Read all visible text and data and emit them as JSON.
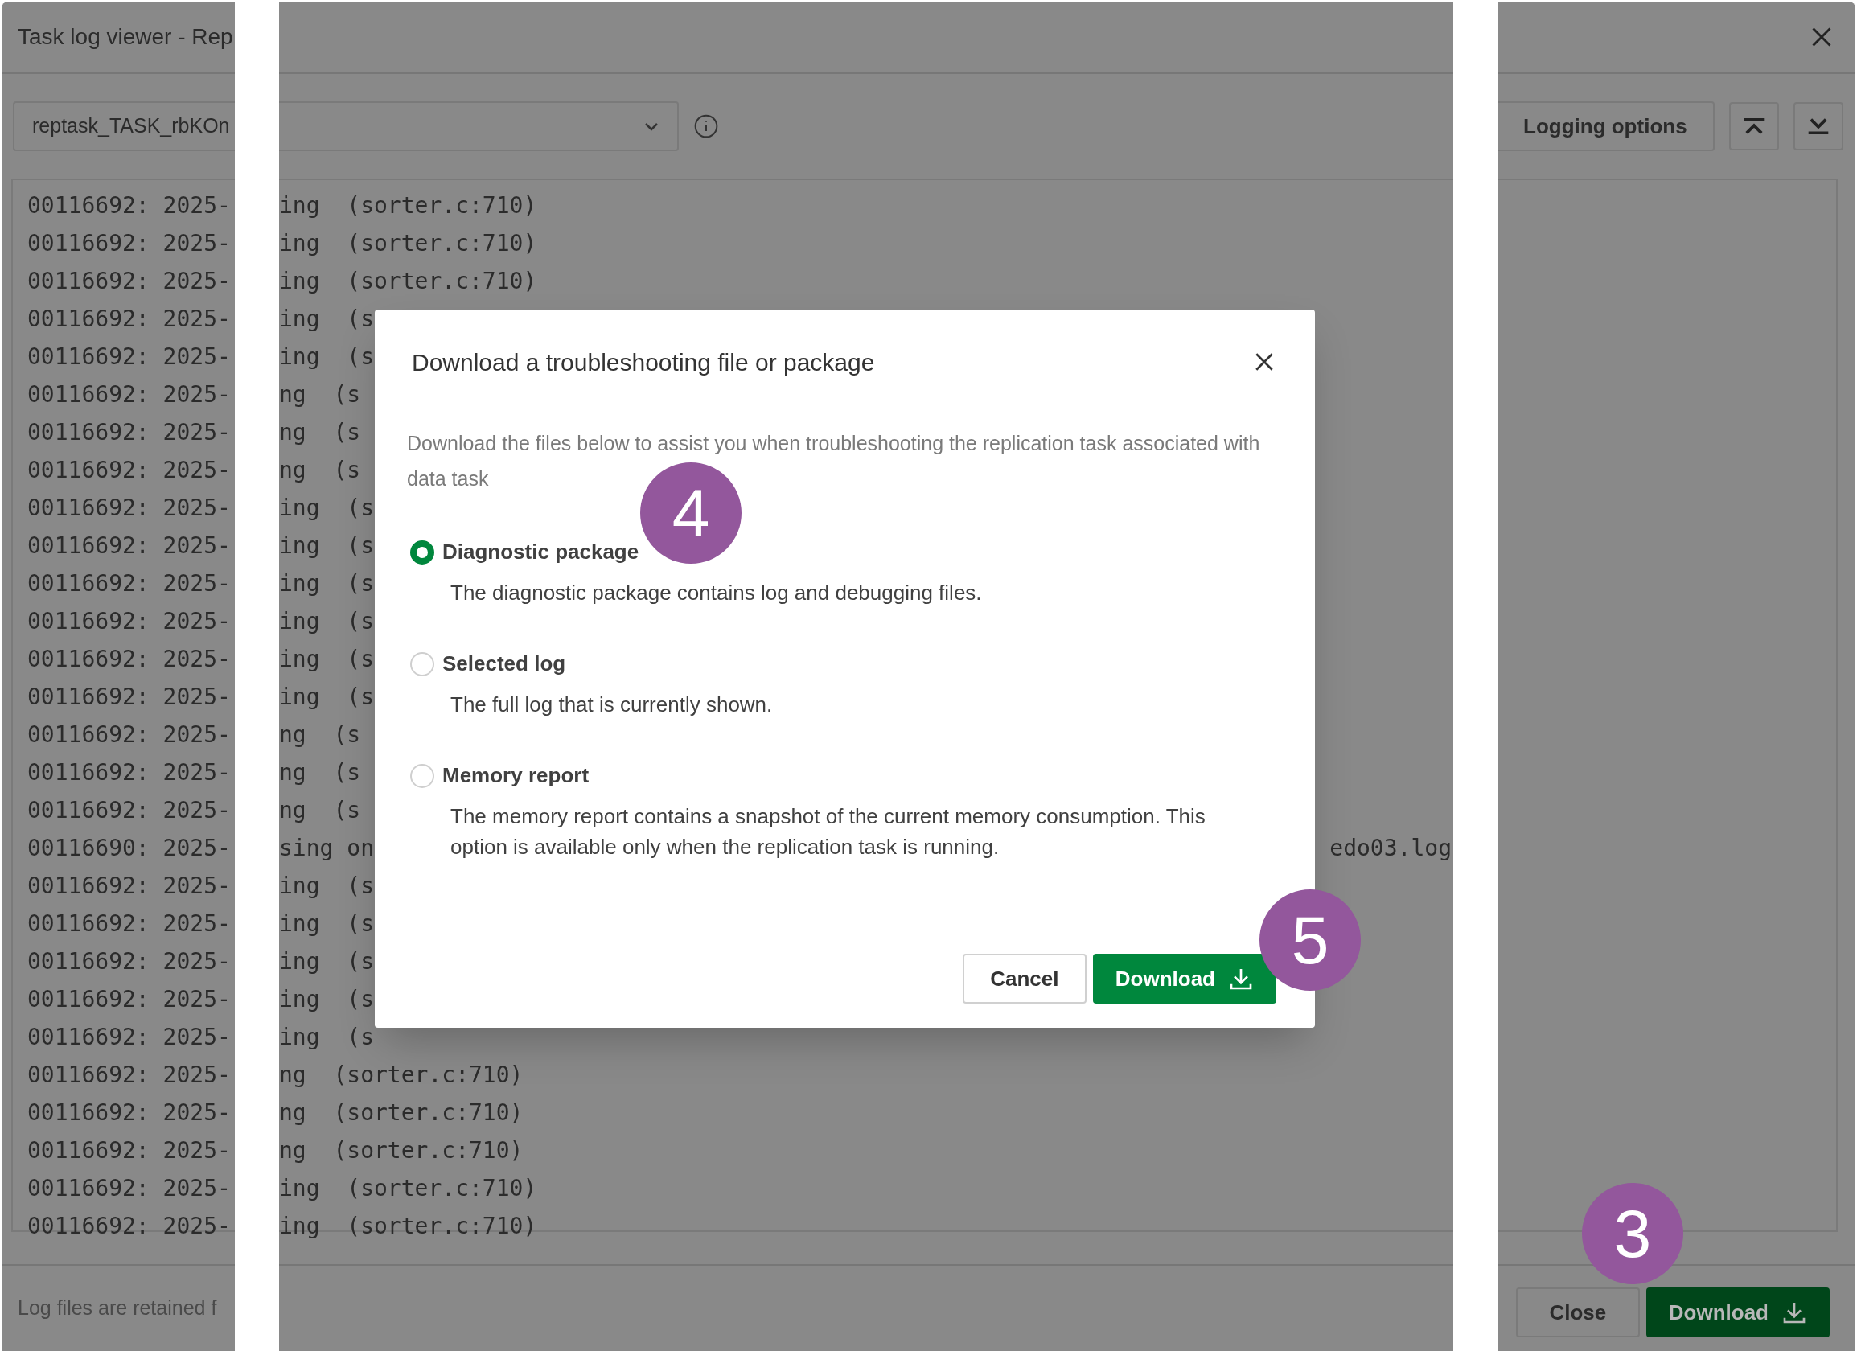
{
  "window": {
    "title": "Task log viewer - Rep"
  },
  "log_selector": {
    "value": "reptask_TASK_rbKOn"
  },
  "toolbar": {
    "logging_options": "Logging options"
  },
  "log": [
    {
      "left": "00116692: 2025-",
      "middle": "ing  (sorter.c:710)"
    },
    {
      "left": "00116692: 2025-",
      "middle": "ing  (sorter.c:710)"
    },
    {
      "left": "00116692: 2025-",
      "middle": "ing  (sorter.c:710)"
    },
    {
      "left": "00116692: 2025-",
      "middle": "ing  (s"
    },
    {
      "left": "00116692: 2025-",
      "middle": "ing  (s"
    },
    {
      "left": "00116692: 2025-",
      "middle": "ng  (s"
    },
    {
      "left": "00116692: 2025-",
      "middle": "ng  (s"
    },
    {
      "left": "00116692: 2025-",
      "middle": "ng  (s"
    },
    {
      "left": "00116692: 2025-",
      "middle": "ing  (s"
    },
    {
      "left": "00116692: 2025-",
      "middle": "ing  (s"
    },
    {
      "left": "00116692: 2025-",
      "middle": "ing  (s"
    },
    {
      "left": "00116692: 2025-",
      "middle": "ing  (s"
    },
    {
      "left": "00116692: 2025-",
      "middle": "ing  (s"
    },
    {
      "left": "00116692: 2025-",
      "middle": "ing  (s"
    },
    {
      "left": "00116692: 2025-",
      "middle": "ng  (s"
    },
    {
      "left": "00116692: 2025-",
      "middle": "ng  (s"
    },
    {
      "left": "00116692: 2025-",
      "middle": "ng  (s"
    },
    {
      "left": "00116690: 2025-",
      "middle": "sing on",
      "right": "edo03.log"
    },
    {
      "left": "00116692: 2025-",
      "middle": "ing  (s"
    },
    {
      "left": "00116692: 2025-",
      "middle": "ing  (s"
    },
    {
      "left": "00116692: 2025-",
      "middle": "ing  (s"
    },
    {
      "left": "00116692: 2025-",
      "middle": "ing  (s"
    },
    {
      "left": "00116692: 2025-",
      "middle": "ing  (s"
    },
    {
      "left": "00116692: 2025-",
      "middle": "ng  (sorter.c:710)"
    },
    {
      "left": "00116692: 2025-",
      "middle": "ng  (sorter.c:710)"
    },
    {
      "left": "00116692: 2025-",
      "middle": "ng  (sorter.c:710)"
    },
    {
      "left": "00116692: 2025-",
      "middle": "ing  (sorter.c:710)"
    },
    {
      "left": "00116692: 2025-",
      "middle": "ing  (sorter.c:710)"
    }
  ],
  "footer": {
    "note": "Log files are retained f",
    "buttons": [
      {
        "label": "Close",
        "kind": "secondary"
      },
      {
        "label": "Download",
        "kind": "primary",
        "callout": "3"
      }
    ]
  },
  "dialog": {
    "title": "Download a troubleshooting file or package",
    "description": "Download the files below to assist you when troubleshooting the replication task associated with data task",
    "options": [
      {
        "label": "Diagnostic package",
        "description": "The diagnostic package contains log and debugging files.",
        "selected": true,
        "callout": "4"
      },
      {
        "label": "Selected log",
        "description": "The full log that is currently shown.",
        "selected": false
      },
      {
        "label": "Memory report",
        "description": "The memory report contains a snapshot of the current memory consumption. This option is available only when the replication task is running.",
        "selected": false
      }
    ],
    "buttons": [
      {
        "label": "Cancel",
        "kind": "secondary"
      },
      {
        "label": "Download",
        "kind": "primary",
        "callout": "5"
      }
    ]
  }
}
